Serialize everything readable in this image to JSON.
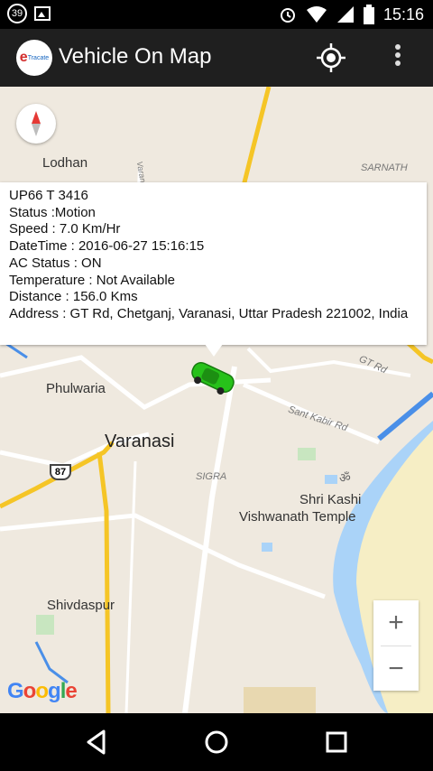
{
  "status_bar": {
    "notification_count": "39",
    "time": "15:16",
    "icons": [
      "notification-badge-icon",
      "gallery-icon",
      "alarm-icon",
      "wifi-icon",
      "signal-icon",
      "battery-icon"
    ]
  },
  "app_bar": {
    "logo_text": "e",
    "logo_subtext": "Tracate",
    "title": "Vehicle On Map",
    "icons": [
      "locate-icon",
      "overflow-menu-icon"
    ]
  },
  "map": {
    "info": {
      "vehicle": "UP66 T 3416",
      "status": "Status :Motion",
      "speed": "Speed : 7.0 Km/Hr",
      "datetime": "DateTime : 2016-06-27 15:16:15",
      "ac_status": "AC Status : ON",
      "temperature": "Temperature : Not Available",
      "distance": "Distance : 156.0 Kms",
      "address": "Address : GT Rd, Chetganj, Varanasi, Uttar Pradesh 221002, India"
    },
    "places": {
      "lodhan": "Lodhan",
      "sarnath": "SARNATH",
      "phulwaria": "Phulwaria",
      "varanasi": "Varanasi",
      "sigra": "SIGRA",
      "shri_kashi": "Shri Kashi",
      "temple": "Vishwanath Temple",
      "shivdaspur": "Shivdaspur",
      "gt_road": "GT Rd",
      "sant_kabir": "Sant Kabir Rd",
      "varanasi_road": "Varanasi",
      "route": "87"
    },
    "zoom_in": "+",
    "zoom_out": "−",
    "google": {
      "letters": [
        "G",
        "o",
        "o",
        "g",
        "l",
        "e"
      ],
      "colors": [
        "#4285F4",
        "#EA4335",
        "#FBBC05",
        "#4285F4",
        "#34A853",
        "#EA4335"
      ]
    },
    "colors": {
      "land": "#EFE9DF",
      "water": "#AAD3F8",
      "river": "#4A8FE8",
      "highway": "#F5C526",
      "car": "#27C11A"
    }
  },
  "nav_bar": {
    "icons": [
      "back-icon",
      "home-icon",
      "recents-icon"
    ]
  }
}
